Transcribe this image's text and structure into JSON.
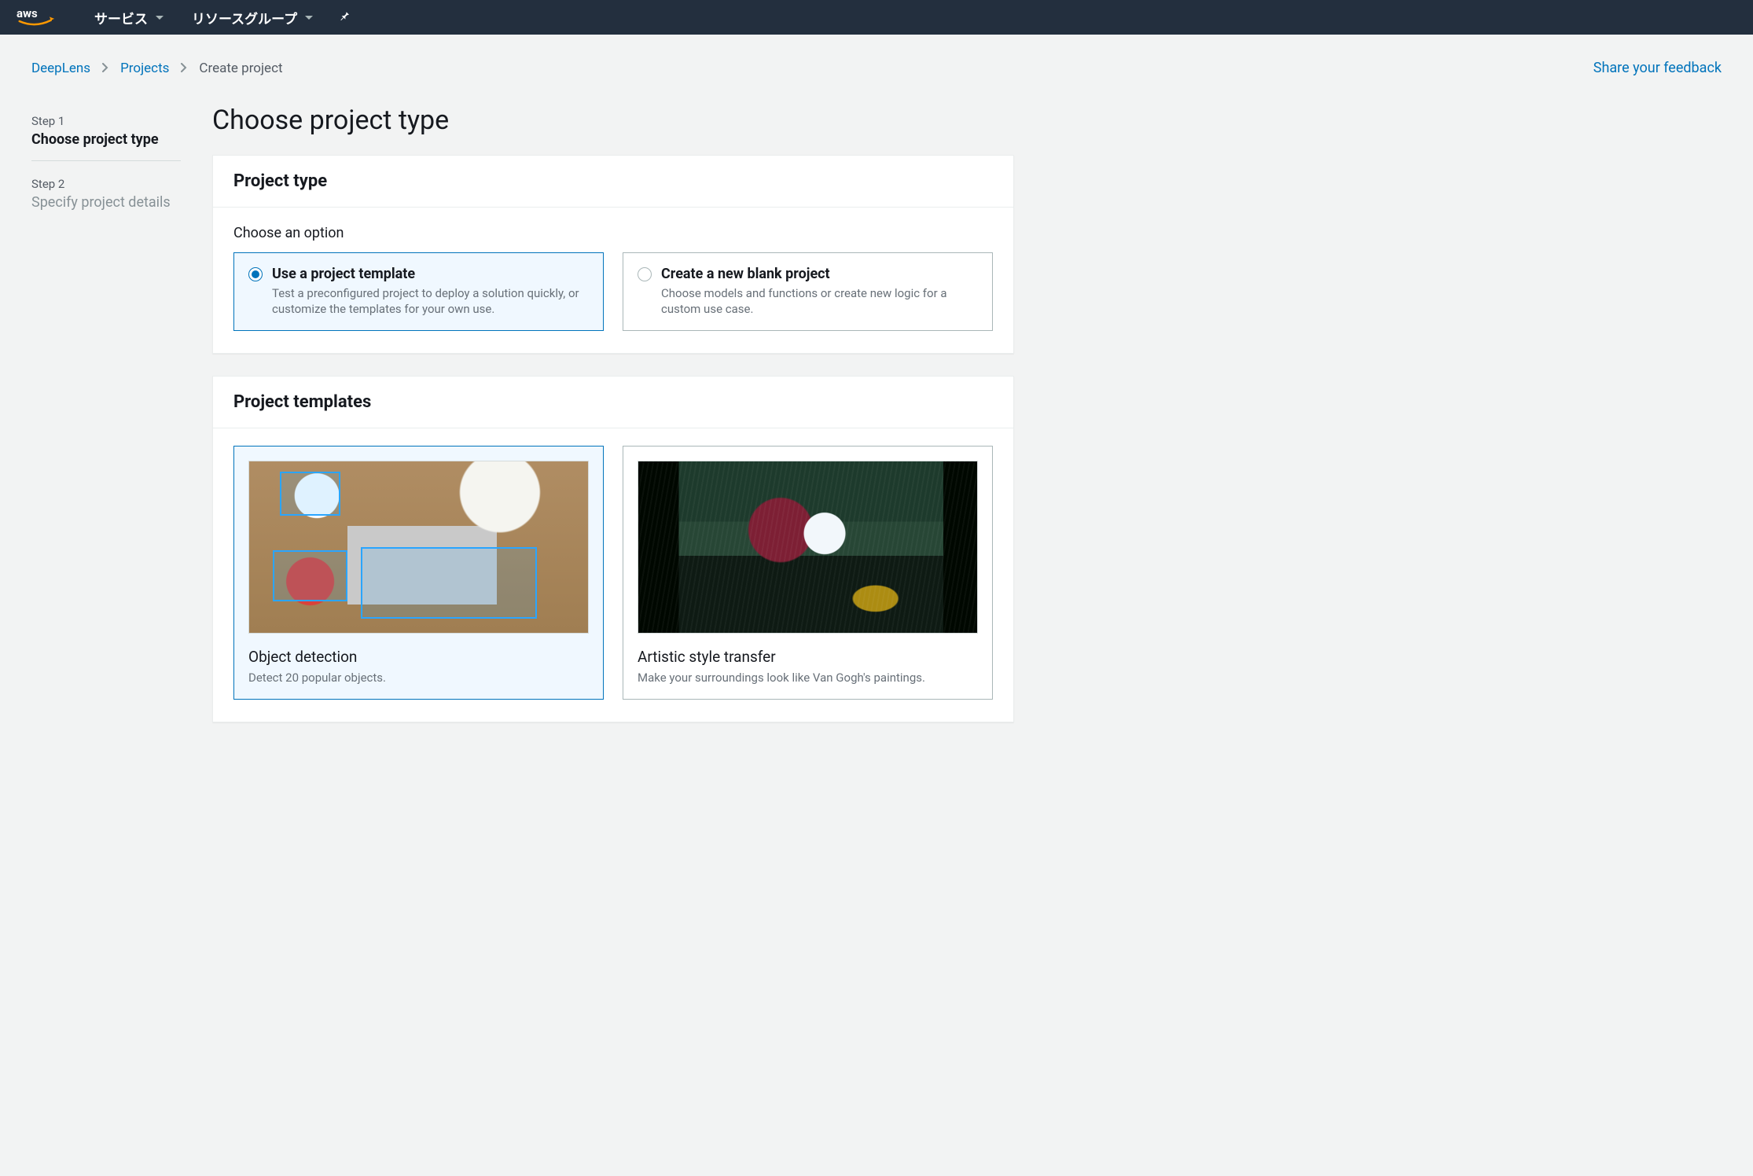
{
  "nav": {
    "services": "サービス",
    "resource_groups": "リソースグループ"
  },
  "topbar": {
    "bc": {
      "root": "DeepLens",
      "parent": "Projects",
      "current": "Create project"
    },
    "feedback": "Share your feedback"
  },
  "steps": [
    {
      "num": "Step 1",
      "title": "Choose project type",
      "active": true
    },
    {
      "num": "Step 2",
      "title": "Specify project details",
      "active": false
    }
  ],
  "page_title": "Choose project type",
  "project_type": {
    "section_title": "Project type",
    "choose_label": "Choose an option",
    "options": [
      {
        "title": "Use a project template",
        "desc": "Test a preconfigured project to deploy a solution quickly, or customize the templates for your own use.",
        "selected": true
      },
      {
        "title": "Create a new blank project",
        "desc": "Choose models and functions or create new logic for a custom use case.",
        "selected": false
      }
    ]
  },
  "templates": {
    "section_title": "Project templates",
    "items": [
      {
        "title": "Object detection",
        "desc": "Detect 20 popular objects.",
        "selected": true
      },
      {
        "title": "Artistic style transfer",
        "desc": "Make your surroundings look like Van Gogh's paintings.",
        "selected": false
      }
    ]
  }
}
